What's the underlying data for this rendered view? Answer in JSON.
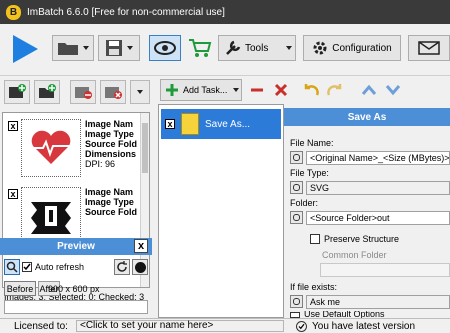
{
  "window": {
    "title": "ImBatch 6.6.0 [Free for non-commercial use]",
    "logo": "B"
  },
  "toolbar": {
    "run_icon": "play-icon",
    "open_icon": "folder-icon",
    "save_icon": "floppy-icon",
    "view_icon": "eye-icon",
    "cart_icon": "cart-icon",
    "tools_label": "Tools",
    "configuration_label": "Configuration",
    "mail_icon": "mail-icon"
  },
  "image_list": {
    "items": [
      {
        "checked": "x",
        "fields": [
          "Image Nam",
          "Image Type",
          "Source Fold",
          "Dimensions",
          "DPI: 96"
        ]
      },
      {
        "checked": "x",
        "fields": [
          "Image Nam",
          "Image Type",
          "Source Fold"
        ]
      }
    ],
    "status": "Images: 3; Selected: 0; Checked: 3"
  },
  "preview": {
    "title": "Preview",
    "close_label": "x",
    "auto_refresh_label": "Auto refresh",
    "before_label": "Before",
    "after_label": "After",
    "size_label": "900 x 600 px"
  },
  "tasks": {
    "add_task_label": "Add Task...",
    "items": [
      {
        "checked": "x",
        "label": "Save As..."
      }
    ]
  },
  "properties": {
    "title": "Save As",
    "file_name_label": "File Name:",
    "file_name_value": "<Original Name>_<Size (MBytes)>_<",
    "file_type_label": "File Type:",
    "file_type_value": "SVG",
    "folder_label": "Folder:",
    "folder_value": "<Source Folder>out",
    "preserve_structure_label": "Preserve Structure",
    "common_folder_label": "Common Folder",
    "if_exists_label": "If file exists:",
    "if_exists_value": "Ask me",
    "use_default_label": "Use Default Options"
  },
  "status_bar": {
    "licensed_label": "Licensed to:",
    "licensed_value": "<Click to set your name here>",
    "update_text": "You have latest version"
  }
}
